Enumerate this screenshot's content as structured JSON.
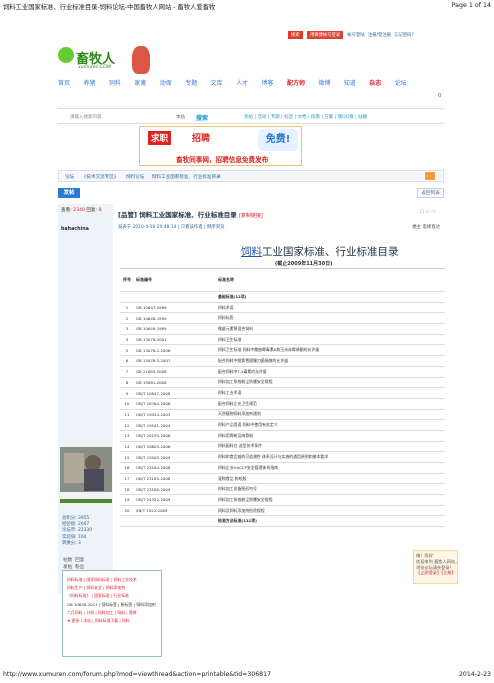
{
  "page_header": {
    "title": "饲料工业国家标准、行业标准目录-饲料论坛-中国畜牧人网站 - 畜牧人爱畜牧",
    "page_no": "Page 1 of 14"
  },
  "page_footer": {
    "url": "http://www.xumuren.com/forum.php?mod=viewthread&action=printable&tid=306817",
    "date": "2014-2-23"
  },
  "topbar": {
    "badge1": "搜索",
    "badge2": "用微博帐号登录",
    "link1": "帐号登陆",
    "link2": "注册/登注册",
    "link3": "忘记密码?"
  },
  "logo": {
    "text": "畜牧人",
    "domain": "xumuren.COM"
  },
  "nav": {
    "items": [
      "首页",
      "养猪",
      "饲料",
      "家禽",
      "动保",
      "专题",
      "文库",
      "人才",
      "博客",
      "配方师",
      "微博",
      "知道",
      "杂志",
      "论坛"
    ],
    "hot": [
      "配方师",
      "杂志"
    ]
  },
  "counter": "0",
  "search": {
    "placeholder": "请输入搜索内容",
    "select": "本站",
    "button": "搜索",
    "links": "热帖 | 活动 | 专题 | 标签 | 文档 | 指南 | 方集 | 我QQ群 | 站群"
  },
  "banner": {
    "b1": "求职",
    "b2": "招聘",
    "b3": "畜牧同事网，招聘信息免费发布",
    "ok": "免费!"
  },
  "breadcrumb": [
    "论坛",
    "《技术交流专区》",
    "饲料论坛",
    "饲料工业国家标准、行业标准目录"
  ],
  "post_bar": {
    "post": "发帖",
    "back": "返回列表"
  },
  "sidebar": {
    "views_label": "查看:",
    "views": "2340",
    "replies_label": "回复:",
    "replies": "8",
    "username": "hahachina",
    "stats": [
      "总积分: 3955",
      "经验值: 2607",
      "论坛币: 22330",
      "实验值: 164",
      "转换分: 3"
    ],
    "pm": "帖数  回复\n发帖  粉丝"
  },
  "post": {
    "title": "[品管] 饲料工业国家标准、行业标准目录",
    "tag": "[复制链接]",
    "meta": "发表于 2010-4-16 20:48:14 | 只看该作者 | 倒序浏览",
    "right_meta": "楼主  电梯直达",
    "doc_title_u": "饲料",
    "doc_title_rest": "工业国家标准、行业标准目录",
    "doc_subtitle": "(截止2009年11月30日)"
  },
  "table": {
    "headers": [
      "序号",
      "标准编号",
      "标准名称"
    ],
    "rows": [
      [
        "",
        "",
        "基础标准(12项)"
      ],
      [
        "1",
        "GB 10647-1989",
        "饲料术语"
      ],
      [
        "2",
        "GB 10648-1999",
        "饲料标签"
      ],
      [
        "3",
        "GB 10649-1989",
        "微量元素预混合饲料"
      ],
      [
        "4",
        "GB 13078-2001",
        "饲料卫生标准"
      ],
      [
        "5",
        "GB 13078.2-2006",
        "饲料卫生标准 饲料中赭曲霉毒素A和玉米赤霉烯酮的允许量"
      ],
      [
        "6",
        "GB 13078.3-2007",
        "配合饲料中脱氧雪腐镰刀菌烯醇的允许量"
      ],
      [
        "7",
        "GB 21693-2008",
        "配合饲料中T-2毒素的允许量"
      ],
      [
        "8",
        "GB 19081-2008",
        "饲料加工系统粉尘防爆安全规程"
      ],
      [
        "9",
        "GB/T 10647-2008",
        "饲料工业术语"
      ],
      [
        "10",
        "GB/T 16764-2006",
        "配合饲料企业卫生规范"
      ],
      [
        "11",
        "GB/T 19424-2003",
        "天然植物饲料添加剂通则"
      ],
      [
        "12",
        "GB/T 19541-2004",
        "饲料产品用语 饲料中使用有关定义"
      ],
      [
        "13",
        "GB/T 20193-2006",
        "饲料用骨粉及肉骨粉"
      ],
      [
        "14",
        "GB/T 20803-2006",
        "饲料配料仓 选型技术条件"
      ],
      [
        "15",
        "GB/T 22005-2009",
        "饲料和食品链的可追溯性 体系设计与实施的通用原则和基本要求"
      ],
      [
        "16",
        "GB/T 23184-2008",
        "饲料企业HACCP安全管理体系指南"
      ],
      [
        "17",
        "GB/T 23185-2008",
        "宠物食品 狗咬胶"
      ],
      [
        "18",
        "GB/T 23186-2009",
        "饲料加工设备图形符号"
      ],
      [
        "19",
        "GB/T 24352-2009",
        "饲料加工系统粉尘防爆安全规程"
      ],
      [
        "20",
        "SN/T 1922-2009",
        "饲料及饲料添加剂检验规程"
      ],
      [
        "",
        "",
        "检测方法标准(131项)"
      ]
    ]
  },
  "notice": {
    "l1": "嗨！您好：",
    "l2": "欢迎来到 畜牧人网站，",
    "l3": "浏览论坛请先登录！",
    "l4": "【立即登录】【注册】"
  },
  "ad": {
    "lines": [
      "饲料标准 | 国家饲料标准 | 饲料工业技术",
      "饲料生产 | 饲料安全 | 饲料添加剂",
      "《饲料标准》 | 国家标准 | 行业标准",
      "GB 10648-2013 | 饲料标签 | 新标签 | 饲料添加剂",
      "六月饲料 | 分析 | 饲料加工 | 饲料 | 营养",
      "★ 更多 | 本站 | 饲料标准下载 | 饲料"
    ]
  }
}
